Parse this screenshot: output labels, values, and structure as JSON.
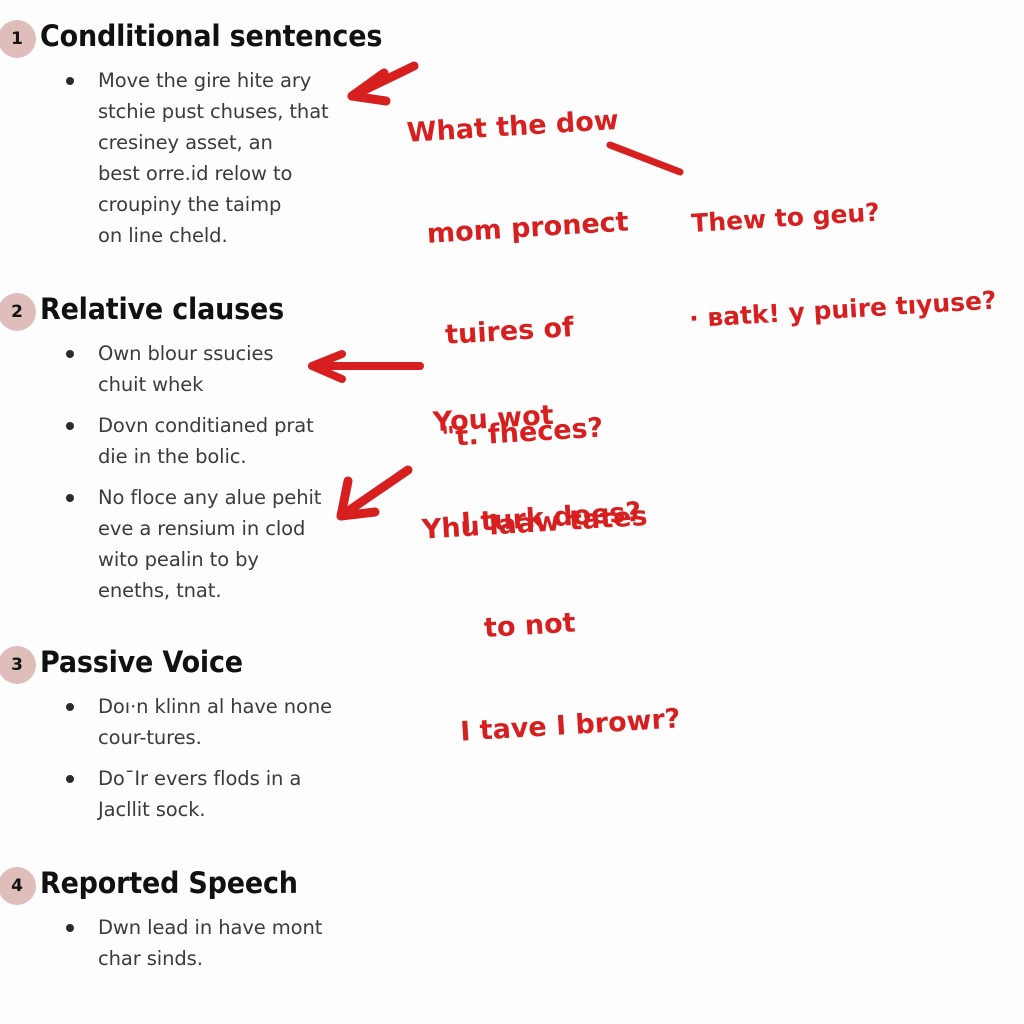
{
  "page": {
    "background_color": "#fdfdfd",
    "ink_color": "#d81f1f",
    "badge_color": "#dfbdbb",
    "body_text_color": "#3b3b3b",
    "heading_text_color": "#111111"
  },
  "sections": [
    {
      "number": "1",
      "heading": "Condlitional sentences",
      "bullets": [
        "Move the gire hite ary\nstchie pust chuses, that\ncresiney asset,  an\nbest orre.id relow to\ncroupiny the taimp\non line cheld."
      ]
    },
    {
      "number": "2",
      "heading": "Relative clauses",
      "bullets": [
        "Own blour ssucies\nchuit whek",
        "Dovn conditianed prat\ndie in the bolic.",
        "No floce any alue pehit\neve a rensium in clod\nwito рealin to by\neneths, tnat."
      ]
    },
    {
      "number": "3",
      "heading": "Passive Voice",
      "bullets": [
        "Doı·n klinn al have none\ncour-tures.",
        "Do¯Ir evers flods in a\nJacllit sock."
      ]
    },
    {
      "number": "4",
      "heading": "Reported Speech",
      "bullets": [
        "Dwn lead in have mont\nchar sinds."
      ]
    }
  ],
  "annotations": [
    {
      "id": "annotation-1",
      "lines": [
        "What the dow",
        "mom pronect",
        "tuires of",
        "\"t. fheces?"
      ]
    },
    {
      "id": "annotation-2",
      "lines": [
        "Thew to geu?",
        "· вatk! y puire tıyuse?"
      ]
    },
    {
      "id": "annotation-3",
      "lines": [
        "You wot",
        "I turk does?"
      ]
    },
    {
      "id": "annotation-4",
      "lines": [
        "Yhu laaw tates",
        "to not",
        "I tave I browr?"
      ]
    }
  ]
}
